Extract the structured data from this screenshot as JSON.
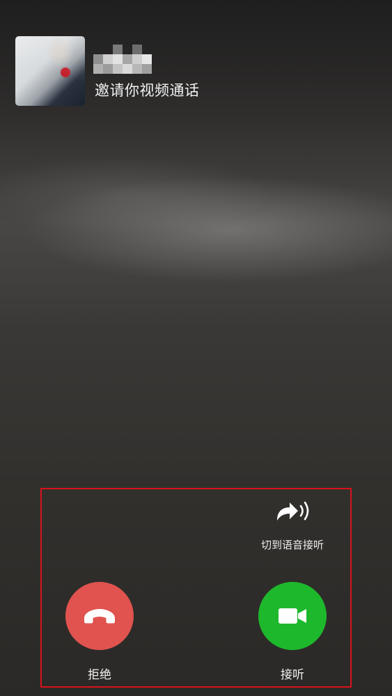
{
  "caller": {
    "avatar_icon": "caller-avatar-photo",
    "name_redacted": true,
    "invite_text": "邀请你视频通话"
  },
  "actions": {
    "switch_to_voice": {
      "label": "切到语音接听",
      "icon": "arrow-sound-waves-icon"
    },
    "decline": {
      "label": "拒绝",
      "icon": "hang-up-phone-icon",
      "color": "#e0534f"
    },
    "accept": {
      "label": "接听",
      "icon": "video-camera-icon",
      "color": "#1db82b"
    }
  },
  "annotation": {
    "highlight_color": "#d8121c"
  }
}
